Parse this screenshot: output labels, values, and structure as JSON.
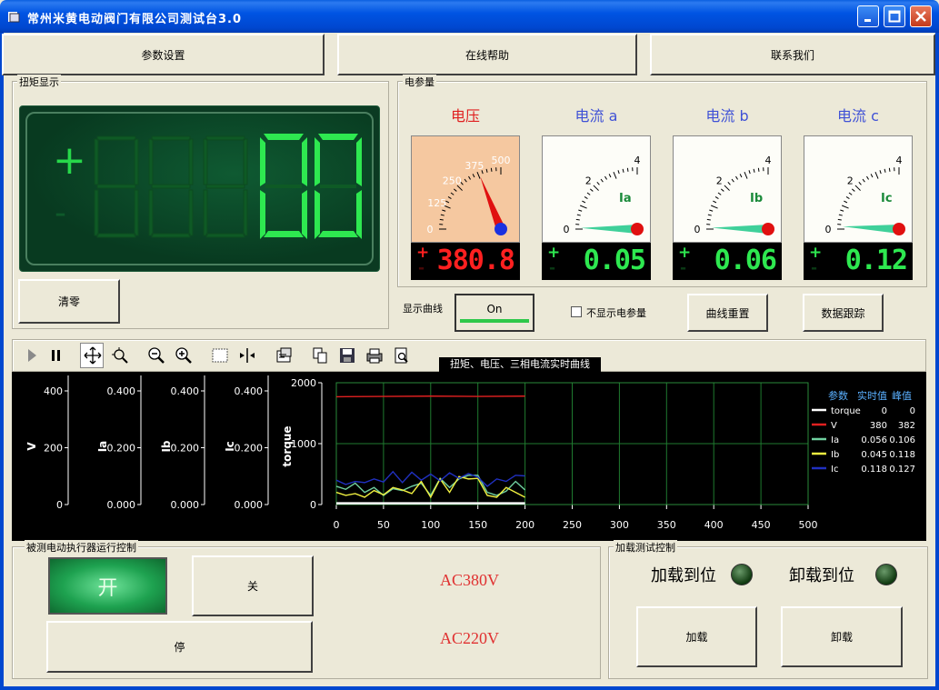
{
  "window": {
    "title": "常州米黄电动阀门有限公司测试台3.0"
  },
  "menu": {
    "items": [
      "参数设置",
      "在线帮助",
      "联系我们"
    ]
  },
  "torque_display": {
    "group_label": "扭矩显示",
    "value": "0",
    "sign": "+",
    "sign_minus": "-",
    "clear_button": "清零"
  },
  "electric": {
    "group_label": "电参量",
    "meters": [
      {
        "title": "电压",
        "scale": [
          "0",
          "125",
          "250",
          "375",
          "500"
        ],
        "reading": "380.8",
        "needle_value": 380.8,
        "max": 500,
        "needle_label": "",
        "plus": "+",
        "minus": "-"
      },
      {
        "title": "电流 a",
        "scale": [
          "0",
          "2",
          "4"
        ],
        "reading": "0.05",
        "needle_value": 0.05,
        "max": 4,
        "needle_label": "Ia",
        "plus": "+",
        "minus": "-"
      },
      {
        "title": "电流 b",
        "scale": [
          "0",
          "2",
          "4"
        ],
        "reading": "0.06",
        "needle_value": 0.06,
        "max": 4,
        "needle_label": "Ib",
        "plus": "+",
        "minus": "-"
      },
      {
        "title": "电流 c",
        "scale": [
          "0",
          "2",
          "4"
        ],
        "reading": "0.12",
        "needle_value": 0.12,
        "max": 4,
        "needle_label": "Ic",
        "plus": "+",
        "minus": "-"
      }
    ],
    "show_curve_label": "显示曲线",
    "show_curve_button": "On",
    "hide_param_checkbox": "不显示电参量",
    "hide_param_checked": false,
    "reset_curve_button": "曲线重置",
    "data_track_button": "数据跟踪"
  },
  "toolbar": {
    "icons": [
      "play-icon",
      "pause-icon",
      "pan-icon",
      "zoom-box-icon",
      "zoom-out-icon",
      "zoom-in-icon",
      "select-rect-icon",
      "cursor-split-icon",
      "properties-icon",
      "copy-icon",
      "save-icon",
      "print-icon",
      "print-preview-icon"
    ],
    "chart_title": "扭矩、电压、三相电流实时曲线"
  },
  "chart_data": {
    "type": "line",
    "x_axis": {
      "ticks": [
        "0",
        "50",
        "100",
        "150",
        "200",
        "250",
        "300",
        "350",
        "400",
        "450",
        "500"
      ],
      "range": [
        0,
        500
      ]
    },
    "axes": [
      {
        "label": "V",
        "ticks": [
          "400",
          "200",
          "0"
        ],
        "range": [
          0,
          450
        ]
      },
      {
        "label": "Ia",
        "ticks": [
          "0.400",
          "0.200",
          "0.000"
        ],
        "range": [
          0,
          0.45
        ]
      },
      {
        "label": "Ib",
        "ticks": [
          "0.400",
          "0.200",
          "0.000"
        ],
        "range": [
          0,
          0.45
        ]
      },
      {
        "label": "Ic",
        "ticks": [
          "0.400",
          "0.200",
          "0.000"
        ],
        "range": [
          0,
          0.45
        ]
      },
      {
        "label": "torque",
        "ticks": [
          "2000",
          "1000",
          "0"
        ],
        "range": [
          0,
          2000
        ]
      }
    ],
    "grid": true,
    "legend": {
      "header": [
        "参数",
        "实时值",
        "峰值"
      ],
      "placement": "right",
      "rows": [
        {
          "name": "torque",
          "value": "0",
          "peak": "0",
          "color": "#ffffff"
        },
        {
          "name": "V",
          "value": "380",
          "peak": "382",
          "color": "#e02020"
        },
        {
          "name": "Ia",
          "value": "0.056",
          "peak": "0.106",
          "color": "#70d0a0"
        },
        {
          "name": "Ib",
          "value": "0.045",
          "peak": "0.118",
          "color": "#f0f040"
        },
        {
          "name": "Ic",
          "value": "0.118",
          "peak": "0.127",
          "color": "#2030c0"
        }
      ]
    },
    "series": [
      {
        "name": "torque",
        "color": "#ffffff",
        "x": [
          0,
          200
        ],
        "y": [
          20,
          20
        ]
      },
      {
        "name": "V",
        "color": "#e02020",
        "x": [
          0,
          50,
          100,
          150,
          200
        ],
        "y": [
          1770,
          1775,
          1780,
          1775,
          1780
        ]
      },
      {
        "name": "Ia",
        "color": "#70d0a0",
        "x": [
          0,
          10,
          20,
          30,
          40,
          50,
          60,
          70,
          80,
          90,
          100,
          110,
          120,
          130,
          140,
          150,
          160,
          170,
          180,
          190,
          200
        ],
        "y": [
          300,
          250,
          350,
          200,
          280,
          150,
          260,
          230,
          300,
          350,
          150,
          430,
          280,
          420,
          480,
          480,
          200,
          150,
          220,
          380,
          240
        ]
      },
      {
        "name": "Ib",
        "color": "#f0f040",
        "x": [
          0,
          10,
          20,
          30,
          40,
          50,
          60,
          70,
          80,
          90,
          100,
          110,
          120,
          130,
          140,
          150,
          160,
          170,
          180,
          190,
          200
        ],
        "y": [
          200,
          150,
          180,
          120,
          230,
          160,
          280,
          240,
          180,
          380,
          120,
          420,
          200,
          460,
          420,
          430,
          150,
          120,
          280,
          200,
          120
        ]
      },
      {
        "name": "Ic",
        "color": "#2030c0",
        "x": [
          0,
          10,
          20,
          30,
          40,
          50,
          60,
          70,
          80,
          90,
          100,
          110,
          120,
          130,
          140,
          150,
          160,
          170,
          180,
          190,
          200
        ],
        "y": [
          400,
          330,
          380,
          360,
          420,
          370,
          540,
          360,
          530,
          400,
          500,
          390,
          520,
          430,
          510,
          450,
          300,
          420,
          380,
          480,
          470
        ]
      }
    ]
  },
  "run_control": {
    "group_label": "被测电动执行器运行控制",
    "open_button": "开",
    "close_button": "关",
    "stop_button": "停",
    "ac380": "AC380V",
    "ac220": "AC220V"
  },
  "load_control": {
    "group_label": "加载测试控制",
    "load_in_place": "加载到位",
    "unload_in_place": "卸载到位",
    "load_button": "加载",
    "unload_button": "卸载"
  }
}
